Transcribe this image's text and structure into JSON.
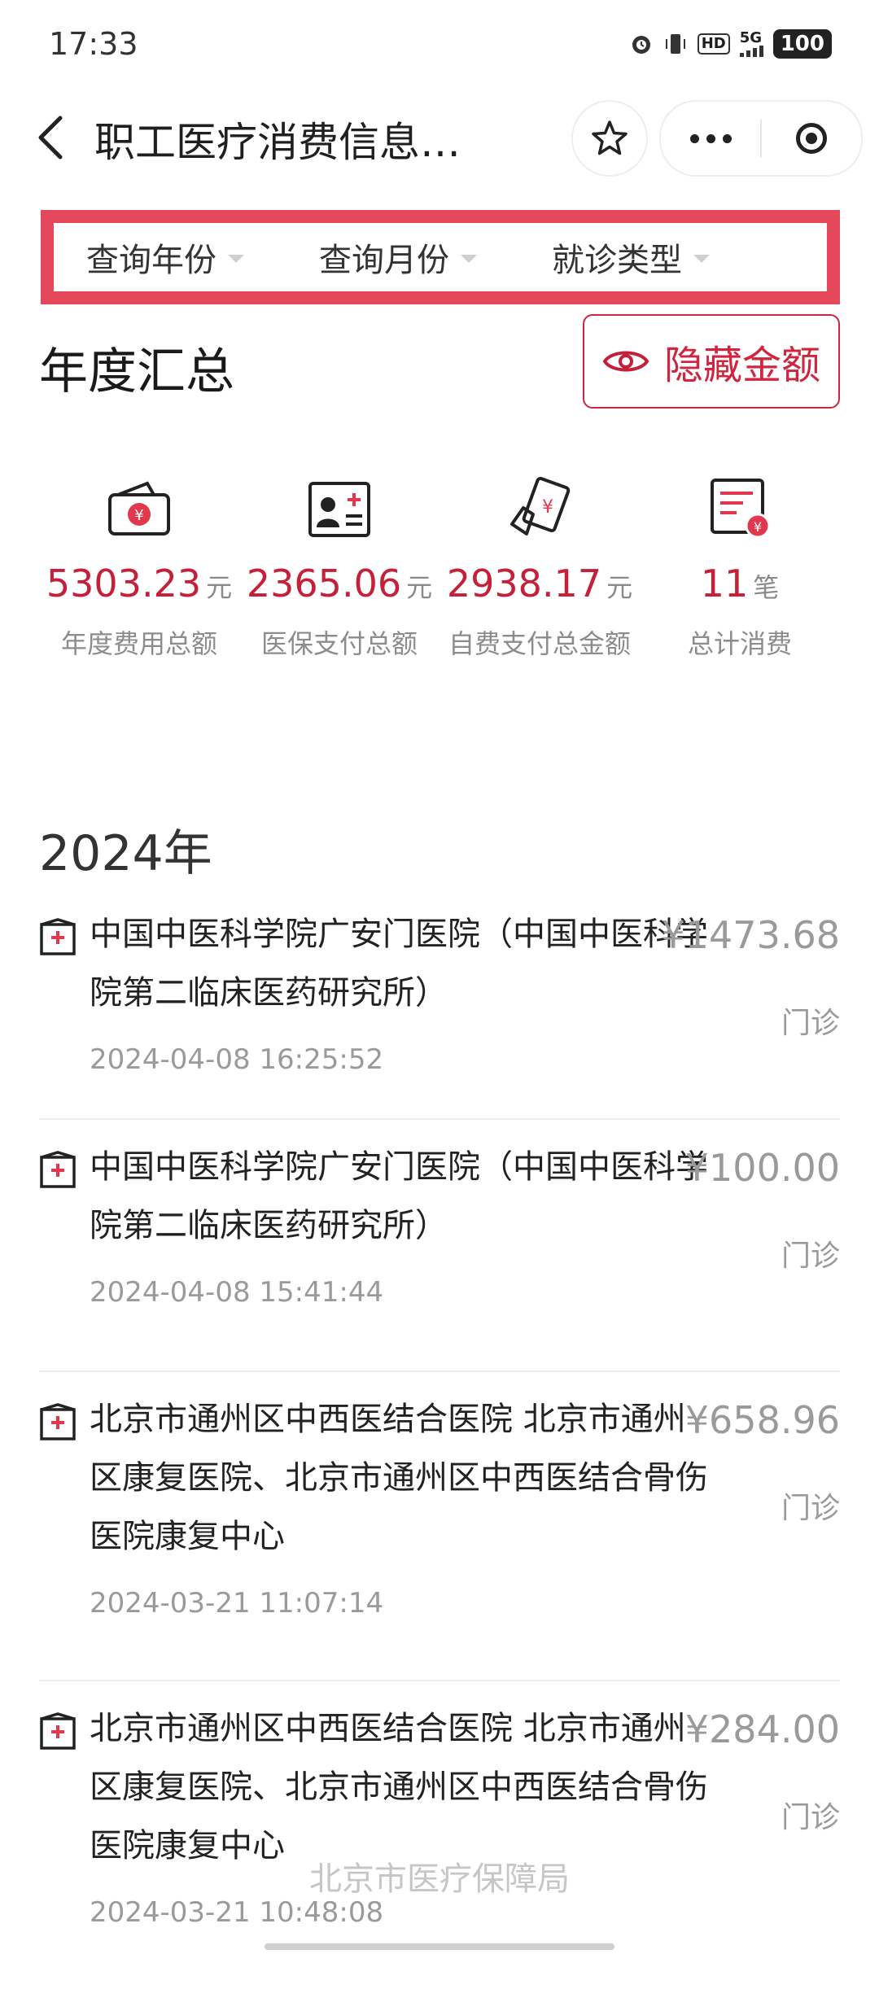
{
  "status_bar": {
    "time": "17:33",
    "hd": "HD",
    "network": "5G",
    "battery": "100"
  },
  "nav": {
    "title": "职工医疗消费信息…"
  },
  "filters": [
    {
      "label": "查询年份"
    },
    {
      "label": "查询月份"
    },
    {
      "label": "就诊类型"
    }
  ],
  "summary": {
    "title": "年度汇总",
    "hide_label": "隐藏金额",
    "stats": [
      {
        "value": "5303.23",
        "unit": "元",
        "label": "年度费用总额",
        "icon": "wallet-yuan-icon"
      },
      {
        "value": "2365.06",
        "unit": "元",
        "label": "医保支付总额",
        "icon": "insurance-card-icon"
      },
      {
        "value": "2938.17",
        "unit": "元",
        "label": "自费支付总金额",
        "icon": "self-pay-icon"
      },
      {
        "value": "11",
        "unit": "笔",
        "label": "总计消费",
        "icon": "receipt-icon"
      }
    ]
  },
  "year_heading": "2024年",
  "records": [
    {
      "hospital": "中国中医科学院广安门医院（中国中医科学院第二临床医药研究所）",
      "amount": "¥1473.68",
      "type": "门诊",
      "time": "2024-04-08 16:25:52"
    },
    {
      "hospital": "中国中医科学院广安门医院（中国中医科学院第二临床医药研究所）",
      "amount": "¥100.00",
      "type": "门诊",
      "time": "2024-04-08 15:41:44"
    },
    {
      "hospital": "北京市通州区中西医结合医院 北京市通州区康复医院、北京市通州区中西医结合骨伤医院康复中心",
      "amount": "¥658.96",
      "type": "门诊",
      "time": "2024-03-21 11:07:14"
    },
    {
      "hospital": "北京市通州区中西医结合医院 北京市通州区康复医院、北京市通州区中西医结合骨伤医院康复中心",
      "amount": "¥284.00",
      "type": "门诊",
      "time": "2024-03-21 10:48:08"
    }
  ],
  "watermark": "北京市医疗保障局",
  "colors": {
    "accent": "#c4203a",
    "filter_border": "#e5475b"
  }
}
